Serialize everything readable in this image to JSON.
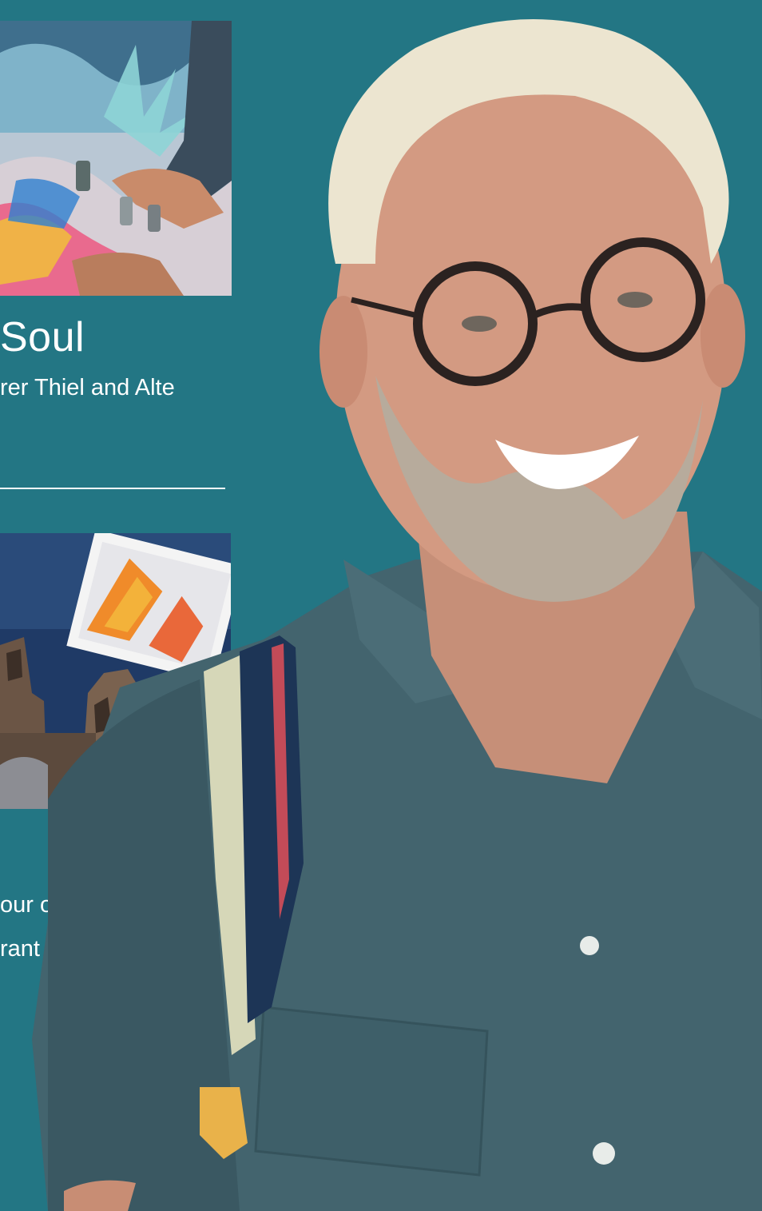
{
  "features": [
    {
      "title": "Soul",
      "subtitle": "rer Thiel and Alte",
      "image": "street-art-painting-photo"
    },
    {
      "image": "church-towers-postcard-photo",
      "lines": [
        "our own postcards",
        "rant south at"
      ]
    }
  ],
  "portrait": "smiling-man-with-glasses-photo",
  "colors": {
    "background": "#237684",
    "text": "#ffffff"
  }
}
